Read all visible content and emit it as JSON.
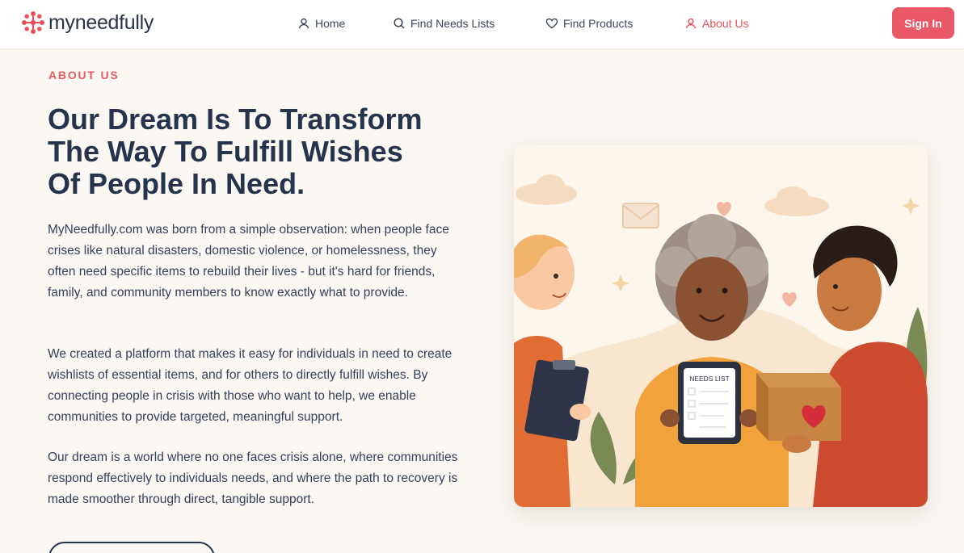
{
  "brand": {
    "name_prefix": "my",
    "name_suffix": "needfully",
    "accent_color": "#e8505b"
  },
  "nav": {
    "items": [
      {
        "label": "Home",
        "icon": "user-icon"
      },
      {
        "label": "Find Needs Lists",
        "icon": "search-icon"
      },
      {
        "label": "Find Products",
        "icon": "heart-icon"
      },
      {
        "label": "About Us",
        "icon": "user-icon",
        "active": true
      }
    ],
    "sign_in": "Sign In"
  },
  "about": {
    "eyebrow": "ABOUT US",
    "headline": {
      "l1a": "Our ",
      "l1b": "Dream",
      "l1c": " Is To Transform",
      "l2a": "The Way To ",
      "l2b": "Fulfill Wishes",
      "l3a": "Of ",
      "l3b": "People",
      "l3c": " In ",
      "l3d": "Need",
      "l3e": "."
    },
    "paragraphs": [
      "MyNeedfully.com was born from a simple observation: when people face crises like natural disasters, domestic violence, or homelessness, they often need specific items to rebuild their lives - but it's hard for friends, family, and community members to know exactly what to provide.",
      "We created a platform that makes it easy for individuals in need to create wishlists of essential items, and for others to directly fulfill wishes. By connecting people in crisis with those who want to help, we enable communities to provide targeted, meaningful support.",
      "Our dream is a world where no one faces crisis alone, where communities respond effectively to individuals needs, and where the path to recovery is made smoother through direct, tangible support."
    ],
    "illustration_tablet_text": "NEEDS LIST"
  }
}
